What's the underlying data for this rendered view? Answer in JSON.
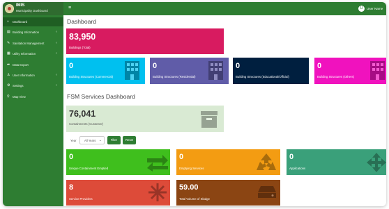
{
  "brand": {
    "name": "IMIS",
    "subtitle": "Municipality Dashboard"
  },
  "user": {
    "avatar_letter": "U",
    "name": "User Name"
  },
  "sidebar": {
    "items": [
      {
        "label": "Dashboard",
        "icon": "dashboard-icon",
        "glyph": "⌂",
        "chevron": ""
      },
      {
        "label": "Building Information",
        "icon": "building-icon",
        "glyph": "▤",
        "chevron": "‹"
      },
      {
        "label": "Sanitation Management",
        "icon": "wrench-icon",
        "glyph": "✎",
        "chevron": "‹"
      },
      {
        "label": "Utility Information",
        "icon": "table-icon",
        "glyph": "▦",
        "chevron": "‹"
      },
      {
        "label": "Data Export",
        "icon": "export-icon",
        "glyph": "➦",
        "chevron": ""
      },
      {
        "label": "User Information",
        "icon": "users-icon",
        "glyph": "♙",
        "chevron": "‹"
      },
      {
        "label": "Settings",
        "icon": "gear-icon",
        "glyph": "⚙",
        "chevron": "‹"
      },
      {
        "label": "Map View",
        "icon": "map-pin-icon",
        "glyph": "⚲",
        "chevron": ""
      }
    ]
  },
  "main": {
    "dashboard_title": "Dashboard",
    "fsm_title": "FSM Services Dashboard",
    "filter_label": "Year",
    "year_select": {
      "value": "All Years",
      "chevron": "⌄"
    },
    "filter_button": "Filter",
    "reset_button": "Reset"
  },
  "cards": {
    "buildings_total": {
      "value": "83,950",
      "label": "Buildings (Total)",
      "color": "#d81b60"
    },
    "commercial": {
      "value": "0",
      "label": "Building Structures (Commercial)",
      "color": "#00c0ef"
    },
    "residential": {
      "value": "0",
      "label": "Building Structures (Residential)",
      "color": "#605ca8"
    },
    "educational": {
      "value": "0",
      "label": "Building Structures (Educational/Official)",
      "color": "#001f3f"
    },
    "others": {
      "value": "0",
      "label": "Building Structures (Others)",
      "color": "#f012be"
    },
    "containments": {
      "value": "76,041",
      "label": "Containments (Customer)",
      "color": "#d9ead3"
    },
    "emptied": {
      "value": "0",
      "label": "Unique Containment Emptied",
      "color": "#3fbf1d"
    },
    "emptying_services": {
      "value": "0",
      "label": "Emptying Services",
      "color": "#f39c12"
    },
    "applications": {
      "value": "0",
      "label": "Applications",
      "color": "#3aa07a"
    },
    "service_providers": {
      "value": "8",
      "label": "Service Providers",
      "color": "#dd4b39"
    },
    "sludge": {
      "value": "59.00",
      "label": "Total Volume of Sludge",
      "color": "#8b4513"
    }
  }
}
